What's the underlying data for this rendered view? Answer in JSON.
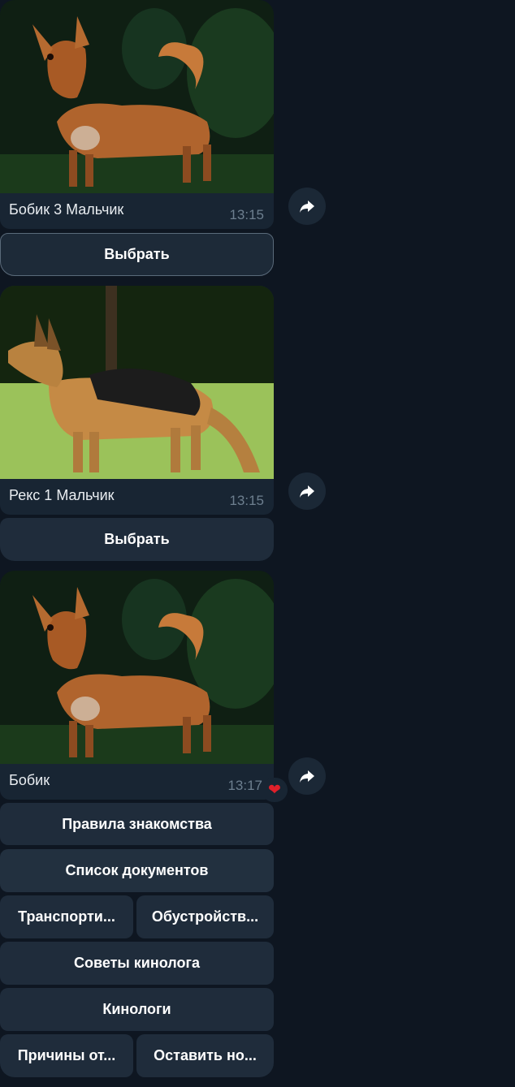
{
  "messages": [
    {
      "caption": "Бобик 3 Мальчик",
      "time": "13:15",
      "photo_icon": "small-red-dog-photo",
      "buttons": [
        "Выбрать"
      ]
    },
    {
      "caption": "Рекс 1 Мальчик",
      "time": "13:15",
      "photo_icon": "german-shepherd-photo",
      "buttons": [
        "Выбрать"
      ]
    },
    {
      "caption": "Бобик",
      "time": "13:17",
      "photo_icon": "small-red-dog-photo",
      "reaction": "❤",
      "buttons": [
        "Правила знакомства",
        "Список документов",
        "Транспорти...",
        "Обустройств...",
        "Советы кинолога",
        "Кинологи",
        "Причины от...",
        "Оставить но..."
      ]
    }
  ],
  "colors": {
    "background": "#0e1621",
    "bubble": "#182533",
    "button": "#1f2c3b",
    "time": "#6d7f8f",
    "reaction": "#e0202a"
  }
}
